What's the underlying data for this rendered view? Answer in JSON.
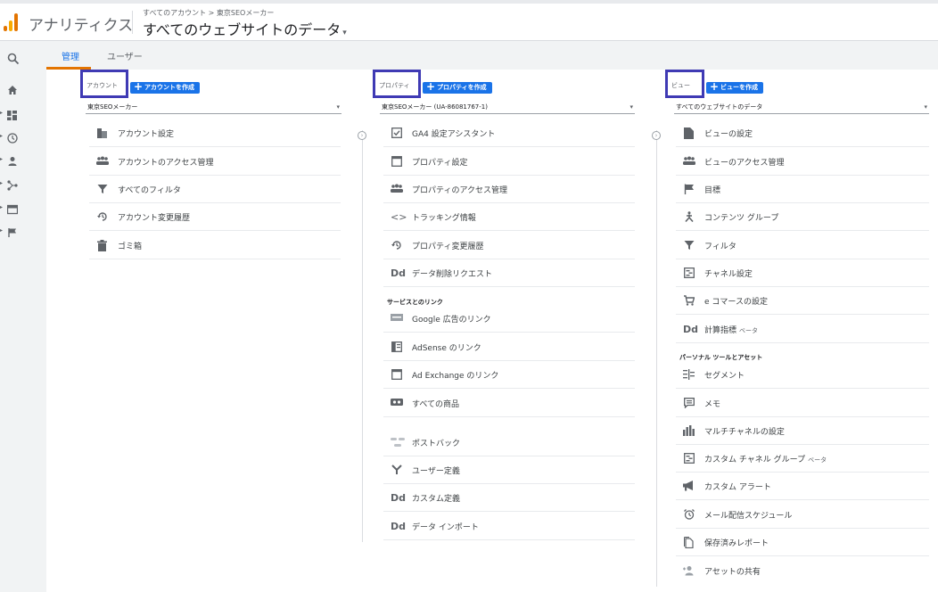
{
  "app": {
    "brand": "アナリティクス",
    "breadcrumb": "すべてのアカウント > 東京SEOメーカー",
    "view_selector": "すべてのウェブサイトのデータ",
    "caret": "▾",
    "logo_colors": [
      "#f9ab00",
      "#e37400",
      "#e37400"
    ]
  },
  "tabs": [
    {
      "label": "管理",
      "active": true
    },
    {
      "label": "ユーザー",
      "active": false
    }
  ],
  "leftnav": {
    "icons": [
      "search-icon",
      "home-icon",
      "customization-icon",
      "realtime-icon",
      "audience-icon",
      "acquisition-icon",
      "behavior-icon",
      "conversions-icon"
    ]
  },
  "account": {
    "heading": "アカウント",
    "create_label": "アカウントを作成",
    "selector_value": "東京SEOメーカー",
    "items": [
      {
        "label": "アカウント設定",
        "icon": "building-icon"
      },
      {
        "label": "アカウントのアクセス管理",
        "icon": "people-icon"
      },
      {
        "label": "すべてのフィルタ",
        "icon": "filter-icon"
      },
      {
        "label": "アカウント変更履歴",
        "icon": "history-icon"
      },
      {
        "label": "ゴミ箱",
        "icon": "trash-icon"
      }
    ]
  },
  "property": {
    "heading": "プロパティ",
    "create_label": "プロパティを作成",
    "selector_value": "東京SEOメーカー (UA-86081767-1)",
    "items": [
      {
        "label": "GA4 設定アシスタント",
        "icon": "checkbox-icon"
      },
      {
        "label": "プロパティ設定",
        "icon": "window-icon"
      },
      {
        "label": "プロパティのアクセス管理",
        "icon": "people-icon"
      },
      {
        "label": "トラッキング情報",
        "icon": "code-icon",
        "glyph": "<>"
      },
      {
        "label": "プロパティ変更履歴",
        "icon": "history-icon"
      },
      {
        "label": "データ削除リクエスト",
        "icon": "dd-icon",
        "glyph": "Dd"
      }
    ],
    "links_section": "サービスとのリンク",
    "links": [
      {
        "label": "Google 広告のリンク",
        "icon": "ads-icon"
      },
      {
        "label": "AdSense のリンク",
        "icon": "adsense-icon"
      },
      {
        "label": "Ad Exchange のリンク",
        "icon": "adexchange-icon"
      },
      {
        "label": "すべての商品",
        "icon": "link-icon"
      }
    ],
    "more": [
      {
        "label": "ポストバック",
        "icon": "postback-icon"
      },
      {
        "label": "ユーザー定義",
        "icon": "user-defined-icon"
      },
      {
        "label": "カスタム定義",
        "icon": "dd-icon",
        "glyph": "Dd"
      },
      {
        "label": "データ インポート",
        "icon": "dd-icon",
        "glyph": "Dd"
      }
    ]
  },
  "view": {
    "heading": "ビュー",
    "create_label": "ビューを作成",
    "selector_value": "すべてのウェブサイトのデータ",
    "items": [
      {
        "label": "ビューの設定",
        "icon": "document-icon"
      },
      {
        "label": "ビューのアクセス管理",
        "icon": "people-icon"
      },
      {
        "label": "目標",
        "icon": "flag-icon"
      },
      {
        "label": "コンテンツ グループ",
        "icon": "content-group-icon"
      },
      {
        "label": "フィルタ",
        "icon": "filter-icon"
      },
      {
        "label": "チャネル設定",
        "icon": "channel-icon"
      },
      {
        "label": "e コマースの設定",
        "icon": "cart-icon"
      },
      {
        "label": "計算指標",
        "beta": "ベータ",
        "icon": "dd-icon",
        "glyph": "Dd"
      }
    ],
    "personal_section": "パーソナル ツールとアセット",
    "personal": [
      {
        "label": "セグメント",
        "icon": "segment-icon"
      },
      {
        "label": "メモ",
        "icon": "note-icon"
      },
      {
        "label": "マルチチャネルの設定",
        "icon": "bar-chart-icon"
      },
      {
        "label": "カスタム チャネル グループ",
        "beta": "ベータ",
        "icon": "channel-icon"
      },
      {
        "label": "カスタム アラート",
        "icon": "megaphone-icon"
      },
      {
        "label": "メール配信スケジュール",
        "icon": "alarm-icon"
      },
      {
        "label": "保存済みレポート",
        "icon": "saved-report-icon"
      },
      {
        "label": "アセットの共有",
        "icon": "share-person-icon"
      }
    ]
  }
}
